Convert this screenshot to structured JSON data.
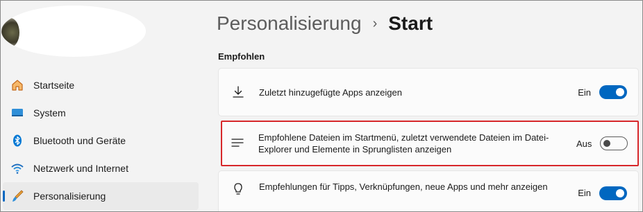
{
  "sidebar": {
    "items": [
      {
        "label": "Startseite",
        "icon": "home-icon"
      },
      {
        "label": "System",
        "icon": "monitor-icon"
      },
      {
        "label": "Bluetooth und Geräte",
        "icon": "bluetooth-icon"
      },
      {
        "label": "Netzwerk und Internet",
        "icon": "wifi-icon"
      },
      {
        "label": "Personalisierung",
        "icon": "brush-icon",
        "active": true
      }
    ]
  },
  "header": {
    "parent": "Personalisierung",
    "separator": "›",
    "current": "Start"
  },
  "section": {
    "title": "Empfohlen"
  },
  "settings": [
    {
      "text": "Zuletzt hinzugefügte Apps anzeigen",
      "state": "Ein",
      "icon": "download-icon",
      "on": true
    },
    {
      "text": "Empfohlene Dateien im Startmenü, zuletzt verwendete Dateien im Datei-Explorer und Elemente in Sprunglisten anzeigen",
      "state": "Aus",
      "icon": "list-icon",
      "on": false
    },
    {
      "text": "Empfehlungen für Tipps, Verknüpfungen, neue Apps und mehr anzeigen",
      "state": "Ein",
      "icon": "lightbulb-icon",
      "on": true
    }
  ],
  "colors": {
    "accent": "#0067c0",
    "highlight_border": "#d7272a"
  }
}
